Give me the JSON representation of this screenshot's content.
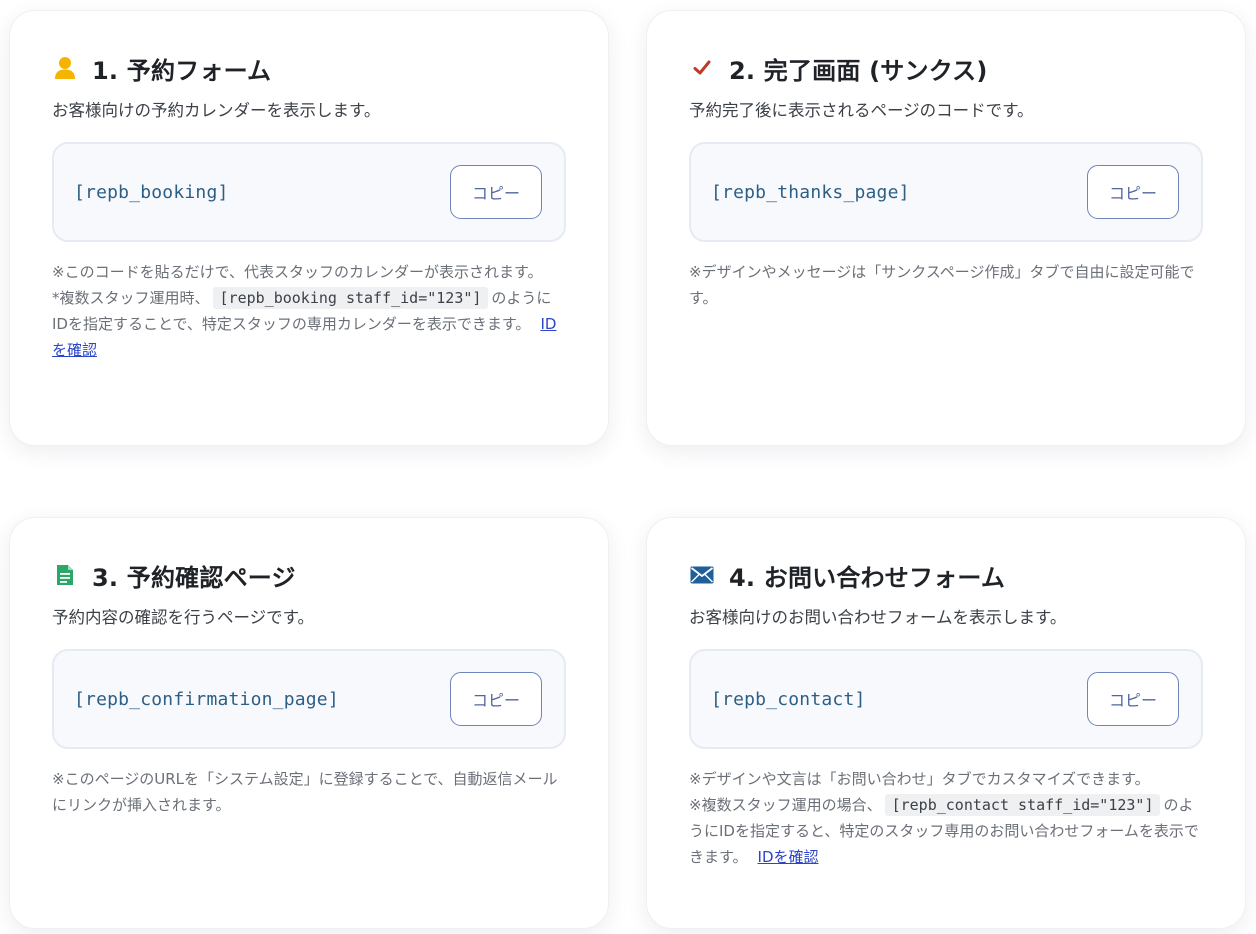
{
  "copy_label": "コピー",
  "cards": [
    {
      "icon": "person-icon",
      "title": "1. 予約フォーム",
      "description": "お客様向けの予約カレンダーを表示します。",
      "code": "[repb_booking]",
      "note_line1": "※このコードを貼るだけで、代表スタッフのカレンダーが表示されます。",
      "note_pre": "*複数スタッフ運用時、",
      "note_code": "[repb_booking staff_id=\"123\"]",
      "note_post": "のようにIDを指定することで、特定スタッフの専用カレンダーを表示できます。",
      "link": "IDを確認"
    },
    {
      "icon": "checkmark-icon",
      "title": "2. 完了画面 (サンクス)",
      "description": "予約完了後に表示されるページのコードです。",
      "code": "[repb_thanks_page]",
      "note_line1": "※デザインやメッセージは「サンクスページ作成」タブで自由に設定可能です。"
    },
    {
      "icon": "document-icon",
      "title": "3. 予約確認ページ",
      "description": "予約内容の確認を行うページです。",
      "code": "[repb_confirmation_page]",
      "note_line1": "※このページのURLを「システム設定」に登録することで、自動返信メールにリンクが挿入されます。"
    },
    {
      "icon": "envelope-icon",
      "title": "4. お問い合わせフォーム",
      "description": "お客様向けのお問い合わせフォームを表示します。",
      "code": "[repb_contact]",
      "note_line1": "※デザインや文言は「お問い合わせ」タブでカスタマイズできます。",
      "note_pre": "※複数スタッフ運用の場合、",
      "note_code": "[repb_contact staff_id=\"123\"]",
      "note_post": "のようにIDを指定すると、特定のスタッフ専用のお問い合わせフォームを表示できます。",
      "link": "IDを確認"
    }
  ],
  "colors": {
    "person_icon": "#f5b400",
    "check_icon": "#c0392b",
    "document_icon": "#2ea56b",
    "envelope_icon": "#1f5f9a",
    "link": "#2b45c8"
  }
}
